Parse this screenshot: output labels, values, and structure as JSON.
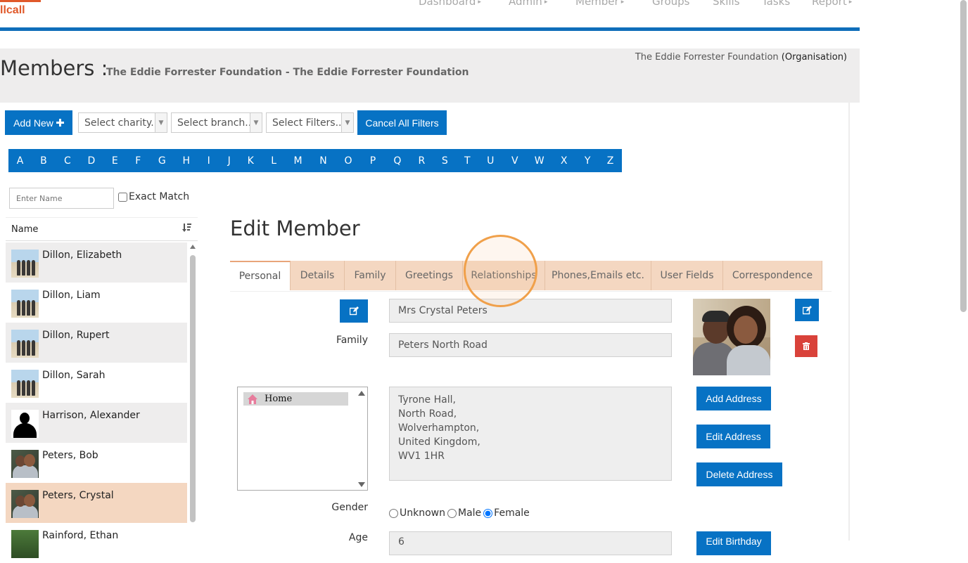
{
  "header": {
    "logo_text": "llcall",
    "nav": [
      {
        "label": "Dashboard",
        "has_caret": true
      },
      {
        "label": "Admin",
        "has_caret": true
      },
      {
        "label": "Member",
        "has_caret": true
      },
      {
        "label": "Groups",
        "has_caret": false
      },
      {
        "label": "Skills",
        "has_caret": false
      },
      {
        "label": "Tasks",
        "has_caret": false
      },
      {
        "label": "Report",
        "has_caret": true
      }
    ],
    "caret_glyph": "▸"
  },
  "title_panel": {
    "title": "Members :",
    "subtitle": "The Eddie Forrester Foundation - The Eddie Forrester Foundation",
    "org_name": "The Eddie Forrester Foundation",
    "org_type": "(Organisation)"
  },
  "toolbar": {
    "add_new_label": "Add New",
    "add_new_icon": "plus-icon",
    "charity_placeholder": "Select charity...",
    "branch_placeholder": "Select branch...",
    "filters_placeholder": "Select Filters...",
    "cancel_filters_label": "Cancel All Filters"
  },
  "alphabet": [
    "A",
    "B",
    "C",
    "D",
    "E",
    "F",
    "G",
    "H",
    "I",
    "J",
    "K",
    "L",
    "M",
    "N",
    "O",
    "P",
    "Q",
    "R",
    "S",
    "T",
    "U",
    "V",
    "W",
    "X",
    "Y",
    "Z"
  ],
  "search": {
    "placeholder": "Enter Name",
    "exact_match_label": "Exact Match"
  },
  "member_list": {
    "header": "Name",
    "sort_icon": "sort-alpha-icon",
    "rows": [
      {
        "name": "Dillon, Elizabeth",
        "thumb": "beach"
      },
      {
        "name": "Dillon, Liam",
        "thumb": "beach"
      },
      {
        "name": "Dillon, Rupert",
        "thumb": "beach"
      },
      {
        "name": "Dillon, Sarah",
        "thumb": "beach"
      },
      {
        "name": "Harrison, Alexander",
        "thumb": "silhouette"
      },
      {
        "name": "Peters, Bob",
        "thumb": "couple"
      },
      {
        "name": "Peters, Crystal",
        "thumb": "couple",
        "selected": true
      },
      {
        "name": "Rainford, Ethan",
        "thumb": "forest"
      }
    ]
  },
  "edit_member": {
    "title": "Edit Member",
    "tabs": [
      {
        "label": "Personal",
        "active": true
      },
      {
        "label": "Details"
      },
      {
        "label": "Family"
      },
      {
        "label": "Greetings"
      },
      {
        "label": "Relationships"
      },
      {
        "label": "Phones,Emails etc."
      },
      {
        "label": "User Fields"
      },
      {
        "label": "Correspondence"
      }
    ],
    "name_value": "Mrs Crystal Peters",
    "family_label": "Family",
    "family_value": "Peters North Road",
    "address_list": [
      "Home"
    ],
    "address_lines": [
      "Tyrone Hall,",
      "North Road,",
      "Wolverhampton,",
      "United Kingdom,",
      "WV1 1HR"
    ],
    "add_address_label": "Add Address",
    "edit_address_label": "Edit Address",
    "delete_address_label": "Delete Address",
    "gender_label": "Gender",
    "gender_options": [
      "Unknown",
      "Male",
      "Female"
    ],
    "gender_selected": "Female",
    "age_label": "Age",
    "age_value": "6",
    "edit_birthday_label": "Edit Birthday"
  },
  "colors": {
    "primary_blue": "#0772c4",
    "header_bar": "#0f6eba",
    "tab_bg": "#f4d7c1",
    "selected_row": "#f4d7c1",
    "delete_red": "#d9423a",
    "highlight_ring": "#f0a04a",
    "logo_orange": "#e0592a"
  }
}
